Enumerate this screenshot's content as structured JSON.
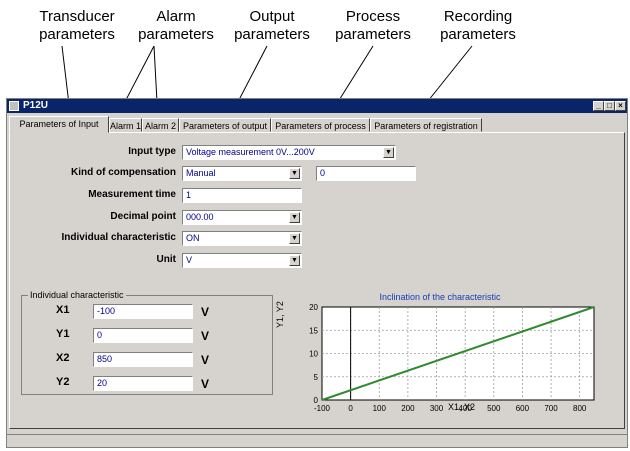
{
  "callouts": {
    "transducer": [
      "Transducer",
      "parameters"
    ],
    "alarm": [
      "Alarm",
      "parameters"
    ],
    "output": [
      "Output",
      "parameters"
    ],
    "process": [
      "Process",
      "parameters"
    ],
    "recording": [
      "Recording",
      "parameters"
    ]
  },
  "window": {
    "title": "P12U",
    "minimize": "_",
    "maximize": "□",
    "close": "×"
  },
  "tabs": [
    "Parameters of Input",
    "Alarm 1",
    "Alarm 2",
    "Parameters of output",
    "Parameters of process",
    "Parameters of registration"
  ],
  "form": {
    "input_type": {
      "label": "Input type",
      "value": "Voltage measurement 0V...200V"
    },
    "compensation": {
      "label": "Kind of compensation",
      "value": "Manual",
      "extra": "0"
    },
    "measurement_time": {
      "label": "Measurement time",
      "value": "1"
    },
    "decimal_point": {
      "label": "Decimal point",
      "value": "000.00"
    },
    "individual": {
      "label": "Individual characteristic",
      "value": "ON"
    },
    "unit": {
      "label": "Unit",
      "value": "V"
    }
  },
  "group": {
    "title": "Individual characteristic",
    "rows": [
      {
        "label": "X1",
        "value": "-100",
        "unit": "V"
      },
      {
        "label": "Y1",
        "value": "0",
        "unit": "V"
      },
      {
        "label": "X2",
        "value": "850",
        "unit": "V"
      },
      {
        "label": "Y2",
        "value": "20",
        "unit": "V"
      }
    ]
  },
  "colors": {
    "line": "#2e8b2e",
    "title_blue": "#1a3cb4",
    "field_text": "#00008b"
  },
  "chart_data": {
    "type": "line",
    "title": "Inclination of the characteristic",
    "xlabel": "X1, X2",
    "ylabel": "Y1, Y2",
    "xlim": [
      -100,
      850
    ],
    "ylim": [
      0,
      20
    ],
    "x_ticks": [
      "-100",
      "0",
      "100",
      "200",
      "300",
      "400",
      "500",
      "600",
      "700",
      "800"
    ],
    "y_ticks": [
      "0",
      "5",
      "10",
      "15",
      "20"
    ],
    "grid": true,
    "series": [
      {
        "x": [
          -100,
          850
        ],
        "y": [
          0,
          20
        ]
      }
    ]
  }
}
